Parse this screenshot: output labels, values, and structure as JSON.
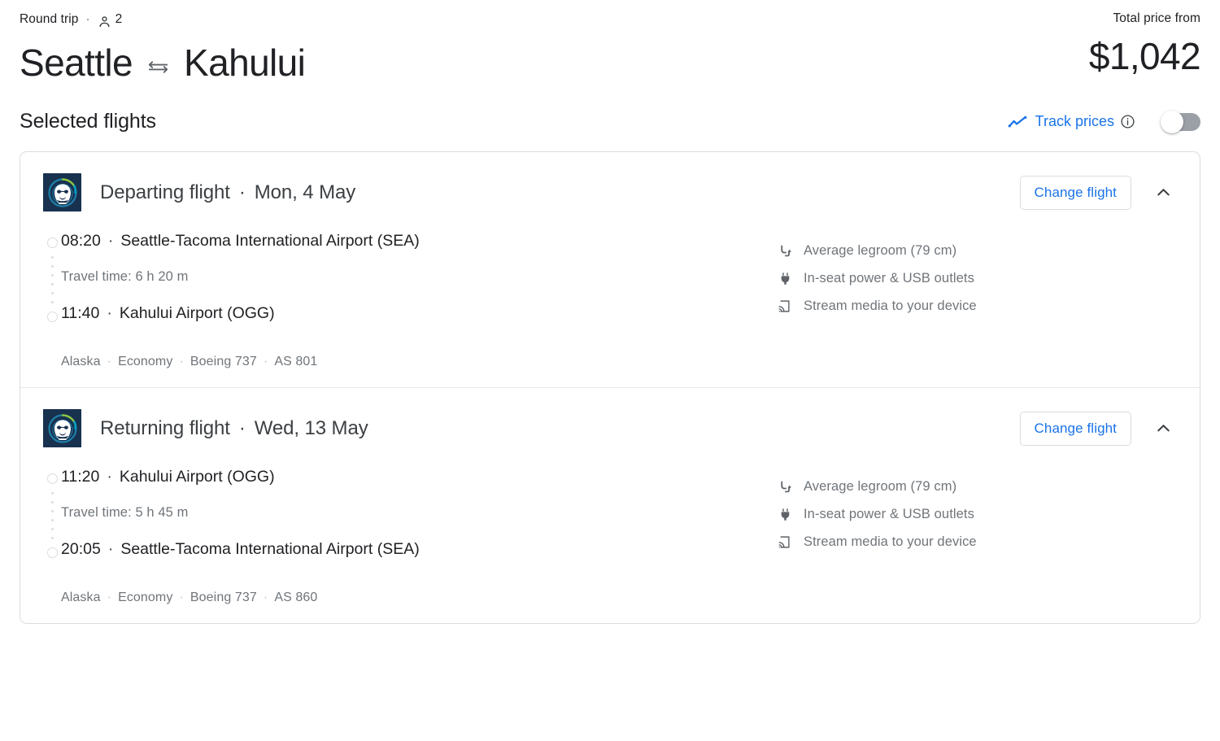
{
  "header": {
    "trip_type": "Round trip",
    "separator": "·",
    "passenger_icon": "person-icon",
    "passenger_count": "2",
    "origin": "Seattle",
    "swap_icon": "swap-horizontal-icon",
    "destination": "Kahului",
    "price_label": "Total price from",
    "price_amount": "$1,042"
  },
  "subbar": {
    "title": "Selected flights",
    "track_icon": "trending-chart-icon",
    "track_label": "Track prices",
    "info_icon": "info-circle-icon",
    "toggle_state": "off"
  },
  "colors": {
    "accent_blue": "#1a73e8",
    "text_primary": "#202124",
    "text_secondary": "#70757a",
    "border": "#dadce0",
    "toggle_track_off": "#9aa0a6",
    "airline_logo_bg": "#1b3a5c"
  },
  "legs": [
    {
      "airline_logo": "alaska-airlines-logo",
      "title": "Departing flight",
      "separator": "·",
      "date": "Mon, 4 May",
      "change_label": "Change flight",
      "collapse_icon": "chevron-up-icon",
      "departure_time": "08:20",
      "departure_airport": "Seattle-Tacoma International Airport (SEA)",
      "travel_time": "Travel time: 6 h 20 m",
      "arrival_time": "11:40",
      "arrival_airport": "Kahului Airport (OGG)",
      "operator": {
        "airline": "Alaska",
        "cabin": "Economy",
        "aircraft": "Boeing 737",
        "flight_number": "AS 801"
      },
      "amenities": [
        {
          "icon": "legroom-icon",
          "label": "Average legroom (79 cm)"
        },
        {
          "icon": "power-plug-icon",
          "label": "In-seat power & USB outlets"
        },
        {
          "icon": "cast-stream-icon",
          "label": "Stream media to your device"
        }
      ]
    },
    {
      "airline_logo": "alaska-airlines-logo",
      "title": "Returning flight",
      "separator": "·",
      "date": "Wed, 13 May",
      "change_label": "Change flight",
      "collapse_icon": "chevron-up-icon",
      "departure_time": "11:20",
      "departure_airport": "Kahului Airport (OGG)",
      "travel_time": "Travel time: 5 h 45 m",
      "arrival_time": "20:05",
      "arrival_airport": "Seattle-Tacoma International Airport (SEA)",
      "operator": {
        "airline": "Alaska",
        "cabin": "Economy",
        "aircraft": "Boeing 737",
        "flight_number": "AS 860"
      },
      "amenities": [
        {
          "icon": "legroom-icon",
          "label": "Average legroom (79 cm)"
        },
        {
          "icon": "power-plug-icon",
          "label": "In-seat power & USB outlets"
        },
        {
          "icon": "cast-stream-icon",
          "label": "Stream media to your device"
        }
      ]
    }
  ]
}
